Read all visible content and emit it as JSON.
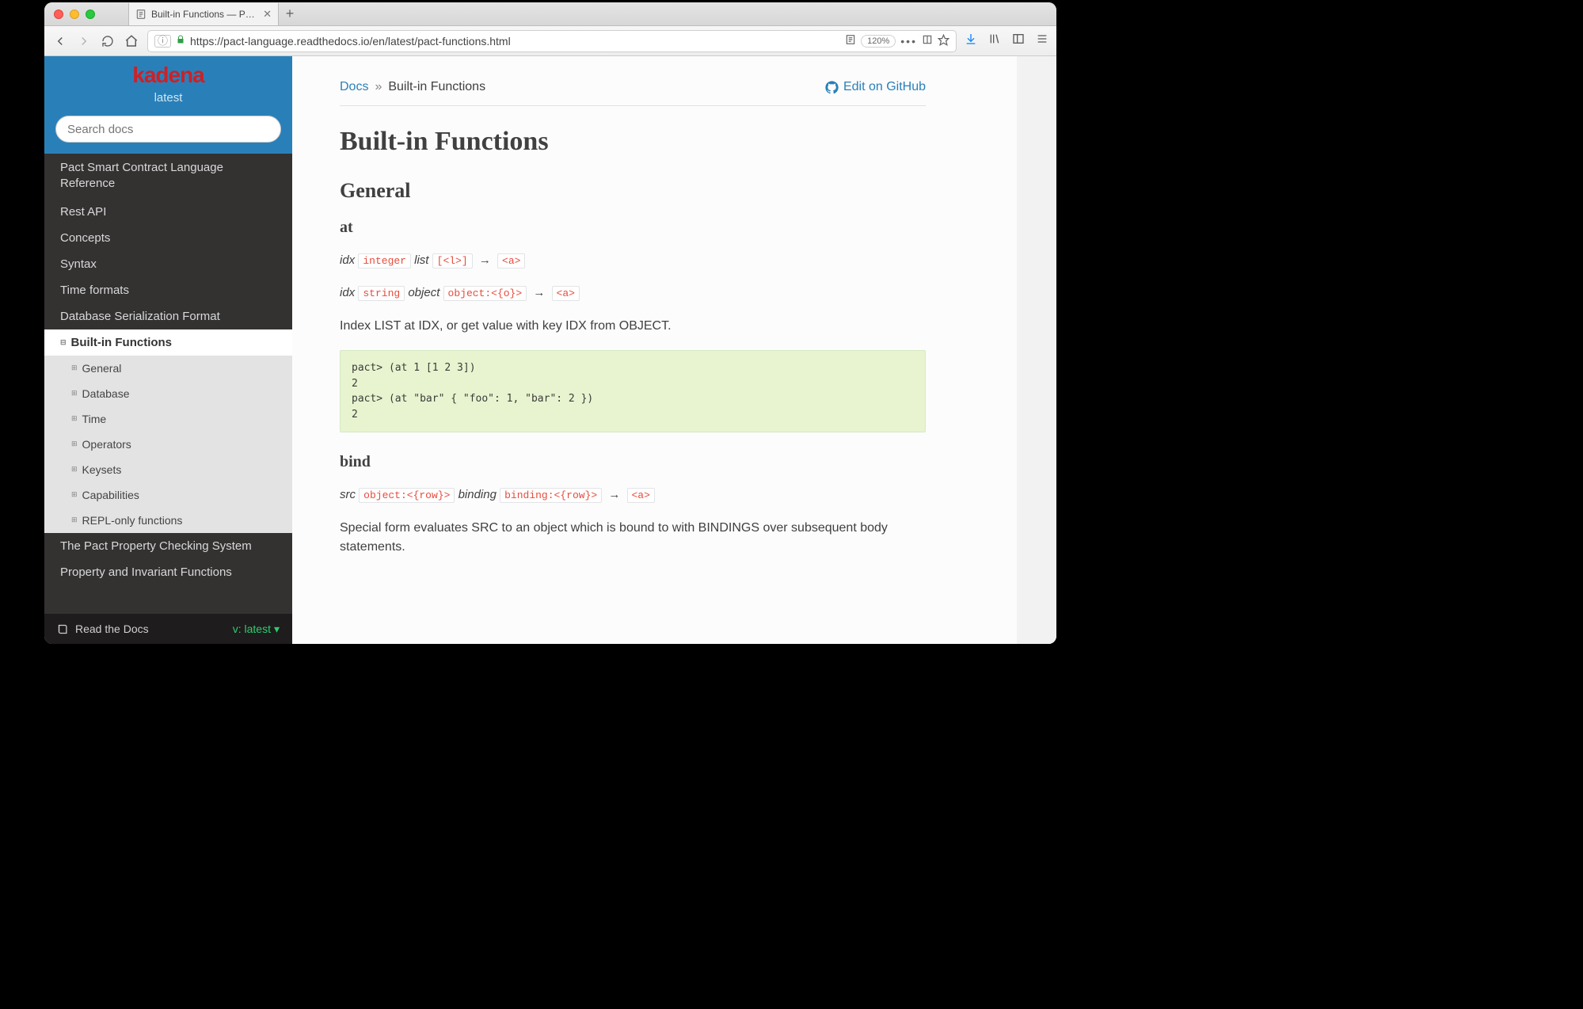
{
  "browser": {
    "tab_title": "Built-in Functions — Pact Lang…",
    "url": "https://pact-language.readthedocs.io/en/latest/pact-functions.html",
    "zoom": "120%",
    "ellipsis": "•••"
  },
  "sidebar": {
    "brand": "kadena",
    "version_label": "latest",
    "search_placeholder": "Search docs",
    "items": [
      {
        "label": "Pact Smart Contract Language Reference"
      },
      {
        "label": "Rest API"
      },
      {
        "label": "Concepts"
      },
      {
        "label": "Syntax"
      },
      {
        "label": "Time formats"
      },
      {
        "label": "Database Serialization Format"
      }
    ],
    "current": "Built-in Functions",
    "subs": [
      {
        "label": "General"
      },
      {
        "label": "Database"
      },
      {
        "label": "Time"
      },
      {
        "label": "Operators"
      },
      {
        "label": "Keysets"
      },
      {
        "label": "Capabilities"
      },
      {
        "label": "REPL-only functions"
      }
    ],
    "after": [
      {
        "label": "The Pact Property Checking System"
      },
      {
        "label": "Property and Invariant Functions"
      }
    ],
    "rtd_label": "Read the Docs",
    "rtd_version": "v: latest"
  },
  "main": {
    "crumb_docs": "Docs",
    "crumb_sep": "»",
    "crumb_current": "Built-in Functions",
    "github_label": "Edit on GitHub",
    "h1": "Built-in Functions",
    "h2_general": "General",
    "h3_at": "at",
    "at_sig1_idx": "idx",
    "at_sig1_integer": "integer",
    "at_sig1_list": "list",
    "at_sig1_list_t": "[<l>]",
    "at_sig1_ret": "<a>",
    "at_sig2_idx": "idx",
    "at_sig2_string": "string",
    "at_sig2_object": "object",
    "at_sig2_object_t": "object:<{o}>",
    "at_sig2_ret": "<a>",
    "at_desc": "Index LIST at IDX, or get value with key IDX from OBJECT.",
    "at_code": "pact> (at 1 [1 2 3])\n2\npact> (at \"bar\" { \"foo\": 1, \"bar\": 2 })\n2",
    "h3_bind": "bind",
    "bind_src": "src",
    "bind_src_t": "object:<{row}>",
    "bind_binding": "binding",
    "bind_binding_t": "binding:<{row}>",
    "bind_ret": "<a>",
    "bind_desc": "Special form evaluates SRC to an object which is bound to with BINDINGS over subsequent body statements."
  }
}
